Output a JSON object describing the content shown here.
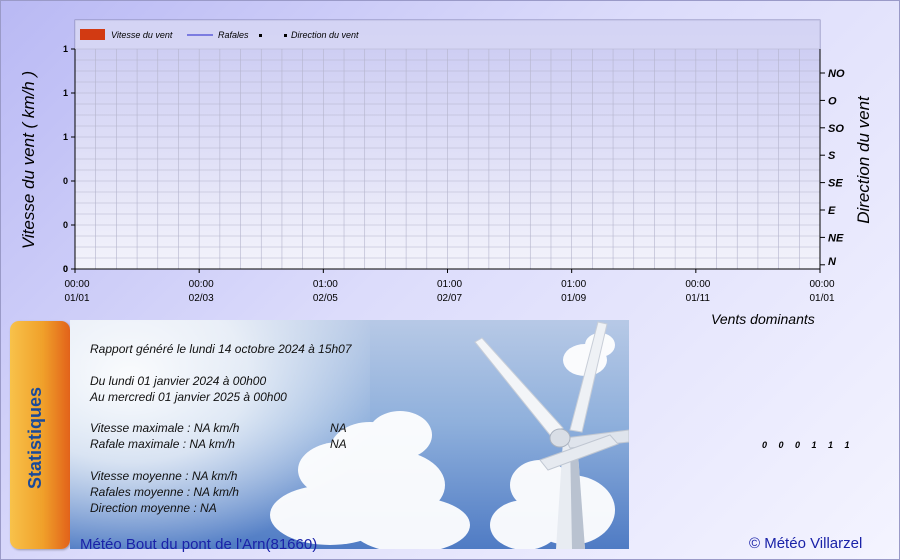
{
  "chart_data": {
    "type": "bar",
    "title": "",
    "ylabel": "Vitesse du vent ( km/h )",
    "y2label": "Direction du vent",
    "xlabel2": "Vents dominants",
    "legend": [
      {
        "name": "Vitesse du vent",
        "color": "#d23a12",
        "kind": "box"
      },
      {
        "name": "Rafales",
        "color": "#2222cc",
        "kind": "line"
      },
      {
        "name": "",
        "color": "#000000",
        "kind": "dot"
      },
      {
        "name": "Direction du vent",
        "color": "#000000",
        "kind": "dot"
      }
    ],
    "y_ticks": [
      "1",
      "1",
      "1",
      "0",
      "0",
      "0"
    ],
    "directions": [
      "NO",
      "O",
      "SO",
      "S",
      "SE",
      "E",
      "NE",
      "N"
    ],
    "x_ticks": [
      {
        "time": "00:00",
        "date": "01/01"
      },
      {
        "time": "00:00",
        "date": "02/03"
      },
      {
        "time": "01:00",
        "date": "02/05"
      },
      {
        "time": "01:00",
        "date": "02/07"
      },
      {
        "time": "01:00",
        "date": "01/09"
      },
      {
        "time": "00:00",
        "date": "01/11"
      },
      {
        "time": "00:00",
        "date": "01/01"
      }
    ],
    "series": [
      {
        "name": "Vitesse du vent",
        "values": []
      },
      {
        "name": "Rafales",
        "values": []
      },
      {
        "name": "Direction du vent",
        "values": []
      }
    ],
    "grid": true
  },
  "stats": {
    "tab_label": "Statistiques",
    "generated": "Rapport généré le lundi 14 octobre 2024 à  15h07",
    "from": "Du lundi 01 janvier 2024 à  00h00",
    "to": "Au mercredi 01 janvier 2025 à  00h00",
    "vmax": "Vitesse maximale : NA km/h",
    "vmax_val": "NA",
    "rmax": "Rafale maximale : NA km/h",
    "rmax_val": "NA",
    "vmoy": "Vitesse moyenne : NA km/h",
    "rmoy": "Rafales moyenne : NA km/h",
    "dmoy": "Direction moyenne : NA"
  },
  "dominant_counts": [
    "0",
    "0",
    "0",
    "1",
    "1",
    "1"
  ],
  "footer": {
    "left": "Météo Bout du pont de l'Arn(81660)",
    "right": "© Météo Villarzel"
  }
}
